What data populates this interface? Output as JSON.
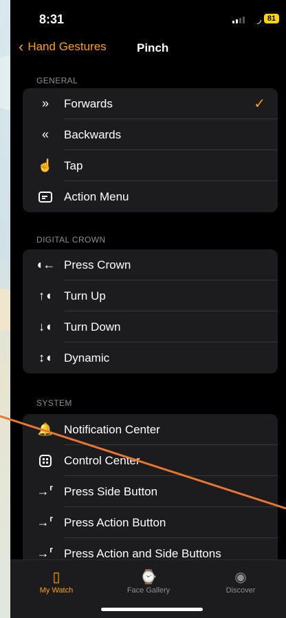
{
  "status": {
    "time": "8:31",
    "battery": "81"
  },
  "nav": {
    "back_label": "Hand Gestures",
    "title": "Pinch"
  },
  "general": {
    "label": "GENERAL",
    "items": [
      {
        "icon": "chevrons-right-icon",
        "label": "Forwards",
        "checked": true
      },
      {
        "icon": "chevrons-left-icon",
        "label": "Backwards"
      },
      {
        "icon": "tap-hand-icon",
        "label": "Tap"
      },
      {
        "icon": "action-menu-icon",
        "label": "Action Menu"
      }
    ]
  },
  "digital_crown": {
    "label": "DIGITAL CROWN",
    "items": [
      {
        "icon": "press-crown-icon",
        "label": "Press Crown"
      },
      {
        "icon": "turn-up-icon",
        "label": "Turn Up"
      },
      {
        "icon": "turn-down-icon",
        "label": "Turn Down"
      },
      {
        "icon": "dynamic-icon",
        "label": "Dynamic"
      }
    ]
  },
  "system": {
    "label": "SYSTEM",
    "items": [
      {
        "icon": "notification-center-icon",
        "label": "Notification Center"
      },
      {
        "icon": "control-center-icon",
        "label": "Control Center"
      },
      {
        "icon": "press-side-button-icon",
        "label": "Press Side Button"
      },
      {
        "icon": "press-action-button-icon",
        "label": "Press Action Button"
      },
      {
        "icon": "press-action-side-buttons-icon",
        "label": "Press Action and Side Buttons"
      }
    ]
  },
  "tabs": [
    {
      "label": "My Watch",
      "icon": "watch-icon",
      "active": true
    },
    {
      "label": "Face Gallery",
      "icon": "face-gallery-icon"
    },
    {
      "label": "Discover",
      "icon": "compass-icon"
    }
  ],
  "colors": {
    "accent": "#ff9f0a",
    "background": "#000000",
    "cell": "#1c1c1e",
    "annotation_line": "#e8782f"
  }
}
